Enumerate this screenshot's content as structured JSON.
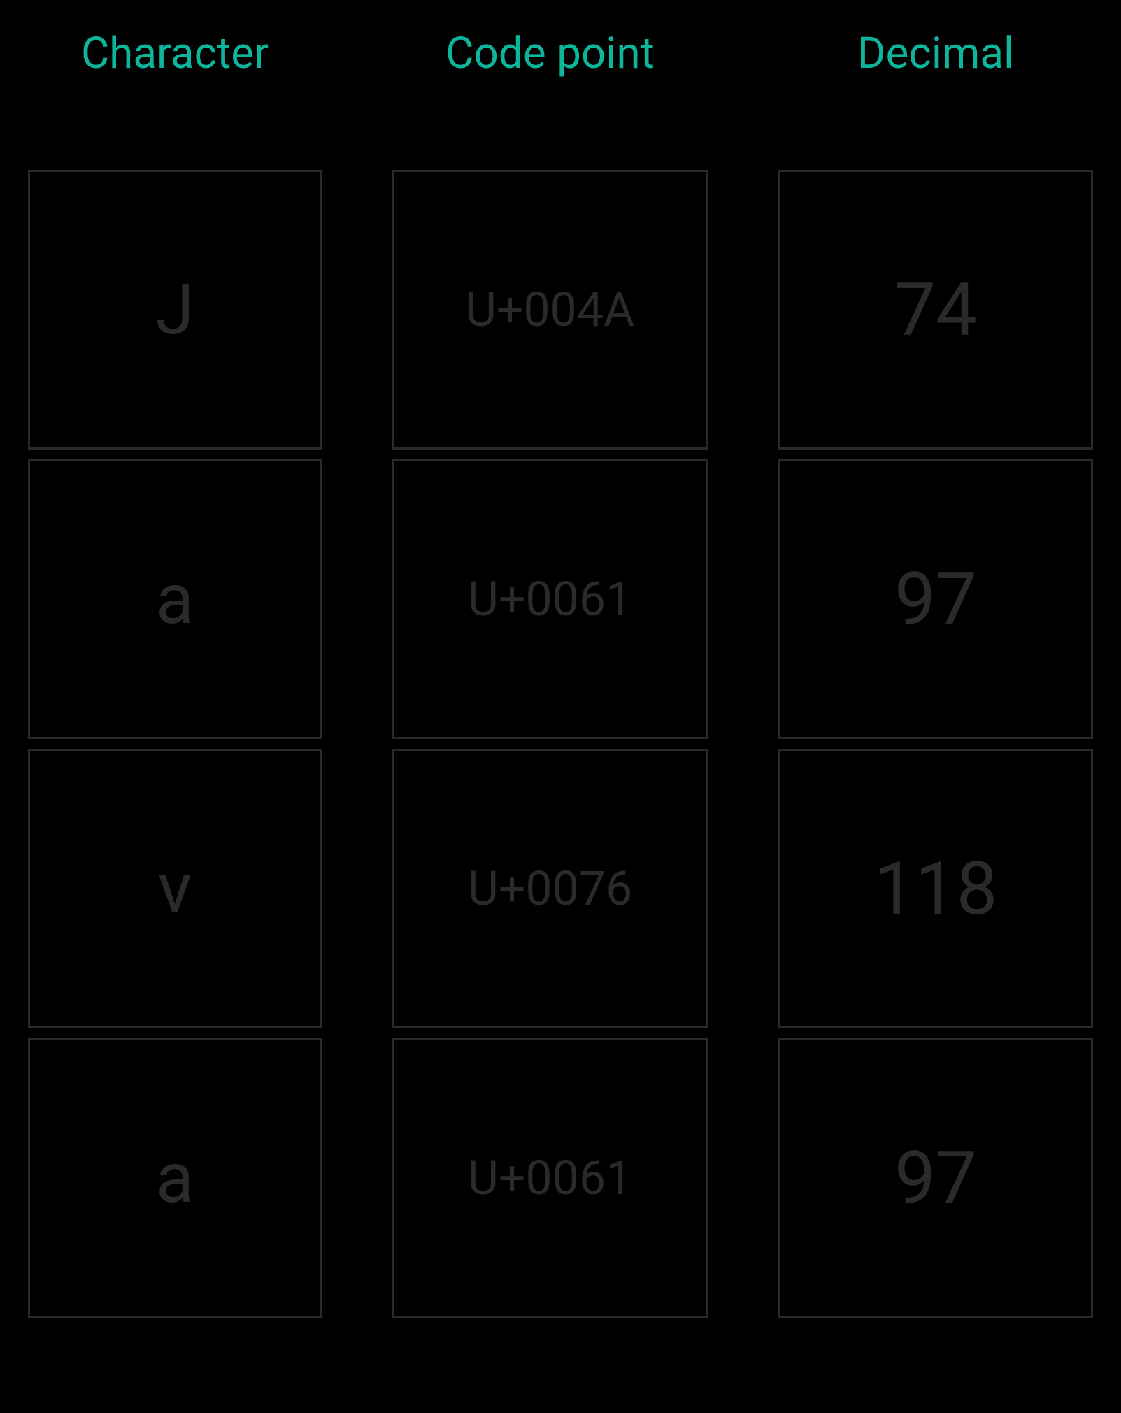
{
  "headers": {
    "character": "Character",
    "codepoint": "Code point",
    "decimal": "Decimal"
  },
  "rows": [
    {
      "character": "J",
      "codepoint": "U+004A",
      "decimal": "74"
    },
    {
      "character": "a",
      "codepoint": "U+0061",
      "decimal": "97"
    },
    {
      "character": "v",
      "codepoint": "U+0076",
      "decimal": "118"
    },
    {
      "character": "a",
      "codepoint": "U+0061",
      "decimal": "97"
    }
  ]
}
